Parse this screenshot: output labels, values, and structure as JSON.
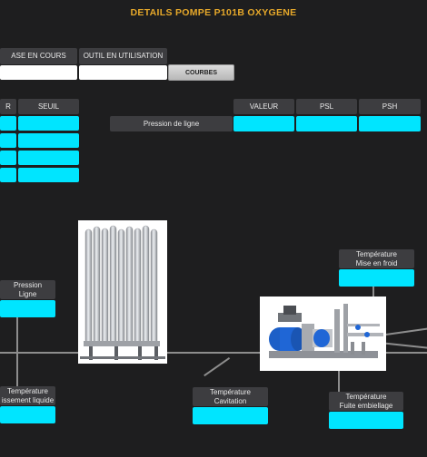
{
  "title": "DETAILS POMPE P101B OXYGENE",
  "top_panel": {
    "phase_header": "ASE EN COURS",
    "outil_header": "OUTIL EN UTILISATION",
    "courbes_button": "COURBES"
  },
  "left_table": {
    "col1_header": "R",
    "col2_header": "SEUIL"
  },
  "pressure_table": {
    "row_label": "Pression de ligne",
    "headers": [
      "VALEUR",
      "PSL",
      "PSH"
    ]
  },
  "sensors": {
    "pression_ligne": "Pression\nLigne",
    "temp_refroidissement": "Température\nissement liquide",
    "temp_cavitation": "Température\nCavitation",
    "temp_mise_en_froid": "Température\nMise en froid",
    "temp_fuite": "Température\nFuite embiellage"
  },
  "colors": {
    "accent_title": "#e6a82a",
    "value_cyan": "#00e5ff",
    "background": "#1e1e1f",
    "label_bg": "#3d3d40"
  }
}
